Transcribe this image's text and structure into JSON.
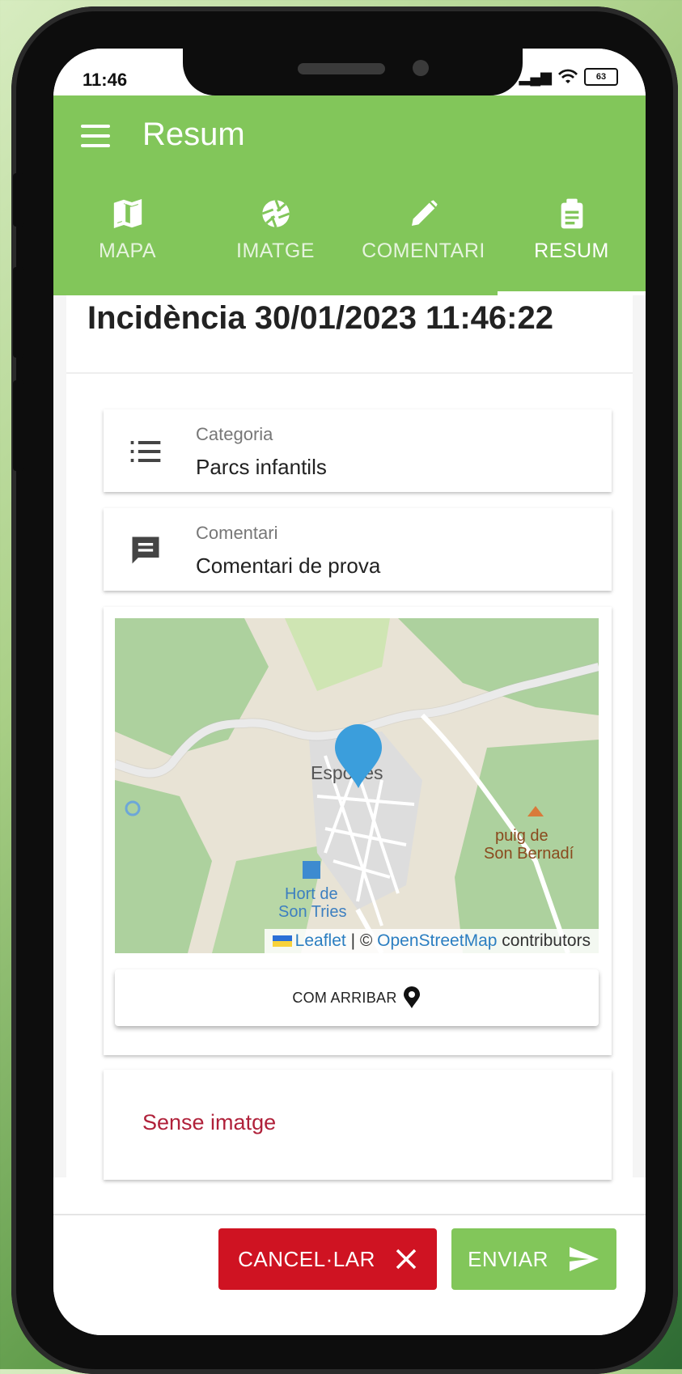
{
  "status_bar": {
    "time": "11:46",
    "battery": "63"
  },
  "app_bar": {
    "title": "Resum",
    "menu_icon": "menu-icon"
  },
  "tabs": [
    {
      "label": "MAPA",
      "icon": "map-icon"
    },
    {
      "label": "IMATGE",
      "icon": "camera-aperture-icon"
    },
    {
      "label": "COMENTARI",
      "icon": "pencil-icon"
    },
    {
      "label": "RESUM",
      "icon": "clipboard-icon",
      "active": true
    }
  ],
  "summary": {
    "heading": "Incidència 30/01/2023 11:46:22",
    "category": {
      "label": "Categoria",
      "value": "Parcs infantils",
      "icon": "list-icon"
    },
    "comment": {
      "label": "Comentari",
      "value": "Comentari de prova",
      "icon": "comment-icon"
    }
  },
  "map": {
    "town_label": "Esporles",
    "places": [
      "puig de",
      "Son Bernadí",
      "Hort de",
      "Son Tries"
    ],
    "attribution": {
      "leaflet": "Leaflet",
      "separator": " | © ",
      "osm": "OpenStreetMap",
      "suffix": " contributors"
    },
    "route_button": "COM ARRIBAR",
    "pin_color": "#3b9edc"
  },
  "image_status": "Sense imatge",
  "actions": {
    "cancel": "CANCEL·LAR",
    "send": "ENVIAR"
  },
  "colors": {
    "primary": "#82c65a",
    "danger": "#cf1322",
    "no_image_text": "#b0213a"
  }
}
